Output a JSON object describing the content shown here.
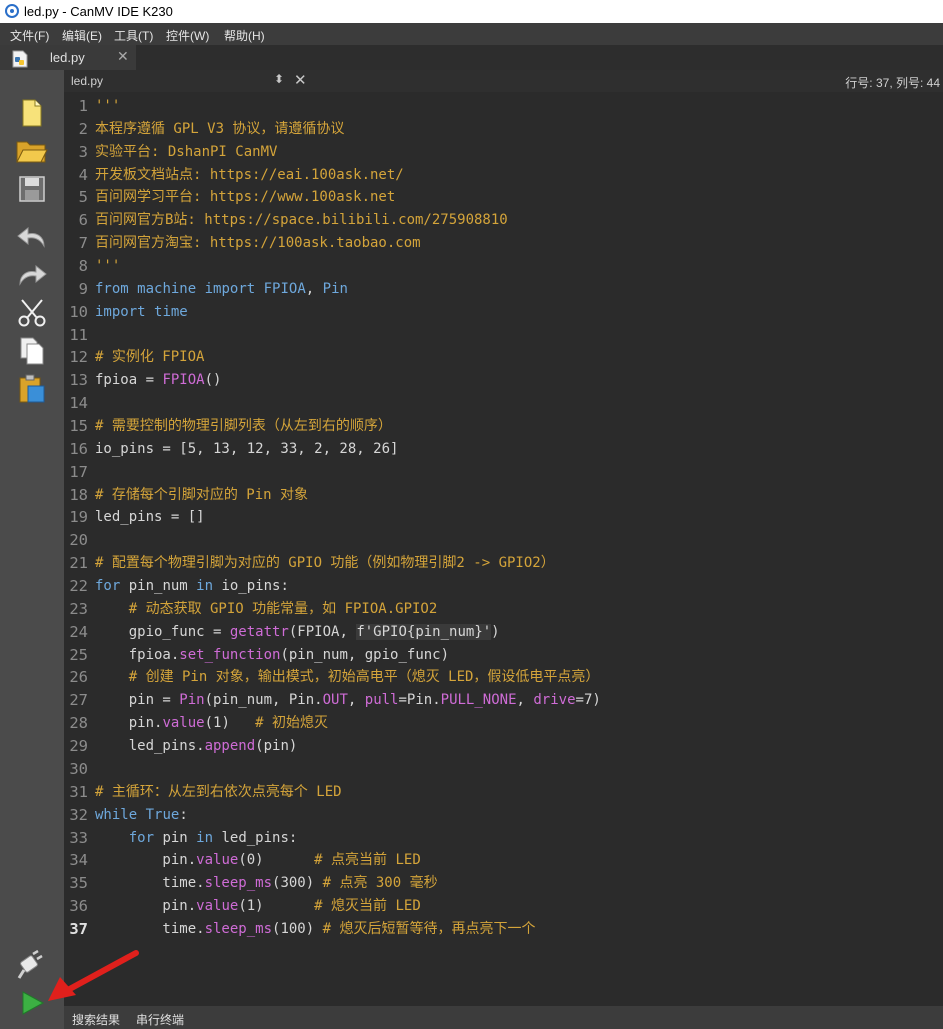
{
  "window": {
    "title": "led.py - CanMV IDE K230"
  },
  "menu": {
    "items": [
      "文件(F)",
      "编辑(E)",
      "工具(T)",
      "控件(W)",
      "帮助(H)"
    ]
  },
  "file_tab": {
    "label": "led.py",
    "close": "✕"
  },
  "editor_header": {
    "filename": "led.py",
    "position": "行号: 37, 列号: 44"
  },
  "toolbar": {
    "tools": [
      "new-file",
      "open-file",
      "save-file",
      "undo",
      "redo",
      "cut",
      "copy",
      "paste"
    ],
    "bottom_tools": [
      "connect",
      "run"
    ]
  },
  "line_numbers": [
    "1",
    "2",
    "3",
    "4",
    "5",
    "6",
    "7",
    "8",
    "9",
    "10",
    "11",
    "12",
    "13",
    "14",
    "15",
    "16",
    "17",
    "18",
    "19",
    "20",
    "21",
    "22",
    "23",
    "24",
    "25",
    "26",
    "27",
    "28",
    "29",
    "30",
    "31",
    "32",
    "33",
    "34",
    "35",
    "36",
    "37"
  ],
  "current_line": 37,
  "code": [
    [
      [
        "c",
        "'''"
      ]
    ],
    [
      [
        "c",
        "本程序遵循 GPL V3 协议，请遵循协议"
      ]
    ],
    [
      [
        "c",
        "实验平台: DshanPI CanMV"
      ]
    ],
    [
      [
        "c",
        "开发板文档站点: https://eai.100ask.net/"
      ]
    ],
    [
      [
        "c",
        "百问网学习平台: https://www.100ask.net"
      ]
    ],
    [
      [
        "c",
        "百问网官方B站: https://space.bilibili.com/275908810"
      ]
    ],
    [
      [
        "c",
        "百问网官方淘宝: https://100ask.taobao.com"
      ]
    ],
    [
      [
        "c",
        "'''"
      ]
    ],
    [
      [
        "k",
        "from"
      ],
      [
        "n",
        " "
      ],
      [
        "k",
        "machine"
      ],
      [
        "n",
        " "
      ],
      [
        "k",
        "import"
      ],
      [
        "n",
        " "
      ],
      [
        "k",
        "FPIOA"
      ],
      [
        "n",
        ", "
      ],
      [
        "k",
        "Pin"
      ]
    ],
    [
      [
        "k",
        "import"
      ],
      [
        "n",
        " "
      ],
      [
        "k",
        "time"
      ]
    ],
    [],
    [
      [
        "c",
        "# 实例化 FPIOA"
      ]
    ],
    [
      [
        "n",
        "fpioa = "
      ],
      [
        "f",
        "FPIOA"
      ],
      [
        "n",
        "()"
      ]
    ],
    [],
    [
      [
        "c",
        "# 需要控制的物理引脚列表（从左到右的顺序）"
      ]
    ],
    [
      [
        "n",
        "io_pins = [5, 13, 12, 33, 2, 28, 26]"
      ]
    ],
    [],
    [
      [
        "c",
        "# 存储每个引脚对应的 Pin 对象"
      ]
    ],
    [
      [
        "n",
        "led_pins = []"
      ]
    ],
    [],
    [
      [
        "c",
        "# 配置每个物理引脚为对应的 GPIO 功能（例如物理引脚2 -> GPIO2）"
      ]
    ],
    [
      [
        "k",
        "for"
      ],
      [
        "n",
        " pin_num "
      ],
      [
        "k",
        "in"
      ],
      [
        "n",
        " io_pins:"
      ]
    ],
    [
      [
        "n",
        "    "
      ],
      [
        "c",
        "# 动态获取 GPIO 功能常量，如 FPIOA.GPIO2"
      ]
    ],
    [
      [
        "n",
        "    gpio_func = "
      ],
      [
        "f",
        "getattr"
      ],
      [
        "n",
        "(FPIOA, "
      ],
      [
        "str",
        "f'GPIO{pin_num}'"
      ],
      [
        "n",
        ")"
      ]
    ],
    [
      [
        "n",
        "    fpioa."
      ],
      [
        "f",
        "set_function"
      ],
      [
        "n",
        "(pin_num, gpio_func)"
      ]
    ],
    [
      [
        "n",
        "    "
      ],
      [
        "c",
        "# 创建 Pin 对象，输出模式，初始高电平（熄灭 LED，假设低电平点亮）"
      ]
    ],
    [
      [
        "n",
        "    pin = "
      ],
      [
        "f",
        "Pin"
      ],
      [
        "n",
        "(pin_num, Pin."
      ],
      [
        "f",
        "OUT"
      ],
      [
        "n",
        ", "
      ],
      [
        "f",
        "pull"
      ],
      [
        "n",
        "=Pin."
      ],
      [
        "f",
        "PULL_NONE"
      ],
      [
        "n",
        ", "
      ],
      [
        "f",
        "drive"
      ],
      [
        "n",
        "=7)"
      ]
    ],
    [
      [
        "n",
        "    pin."
      ],
      [
        "f",
        "value"
      ],
      [
        "n",
        "(1)   "
      ],
      [
        "c",
        "# 初始熄灭"
      ]
    ],
    [
      [
        "n",
        "    led_pins."
      ],
      [
        "f",
        "append"
      ],
      [
        "n",
        "(pin)"
      ]
    ],
    [],
    [
      [
        "c",
        "# 主循环：从左到右依次点亮每个 LED"
      ]
    ],
    [
      [
        "k",
        "while"
      ],
      [
        "n",
        " "
      ],
      [
        "k",
        "True"
      ],
      [
        "n",
        ":"
      ]
    ],
    [
      [
        "n",
        "    "
      ],
      [
        "k",
        "for"
      ],
      [
        "n",
        " pin "
      ],
      [
        "k",
        "in"
      ],
      [
        "n",
        " led_pins:"
      ]
    ],
    [
      [
        "n",
        "        pin."
      ],
      [
        "f",
        "value"
      ],
      [
        "n",
        "(0)      "
      ],
      [
        "c",
        "# 点亮当前 LED"
      ]
    ],
    [
      [
        "n",
        "        time."
      ],
      [
        "f",
        "sleep_ms"
      ],
      [
        "n",
        "(300) "
      ],
      [
        "c",
        "# 点亮 300 毫秒"
      ]
    ],
    [
      [
        "n",
        "        pin."
      ],
      [
        "f",
        "value"
      ],
      [
        "n",
        "(1)      "
      ],
      [
        "c",
        "# 熄灭当前 LED"
      ]
    ],
    [
      [
        "n",
        "        time."
      ],
      [
        "f",
        "sleep_ms"
      ],
      [
        "n",
        "(100) "
      ],
      [
        "c",
        "# 熄灭后短暂等待，再点亮下一个"
      ]
    ]
  ],
  "bottom_tabs": [
    "搜索结果",
    "串行终端"
  ],
  "colors": {
    "comment": "#d4a43a",
    "keyword": "#6ea8dc",
    "function": "#cf6cd6",
    "text": "#d6d6d6",
    "editor_bg": "#2b2b2b",
    "arrow": "#e0201c"
  }
}
